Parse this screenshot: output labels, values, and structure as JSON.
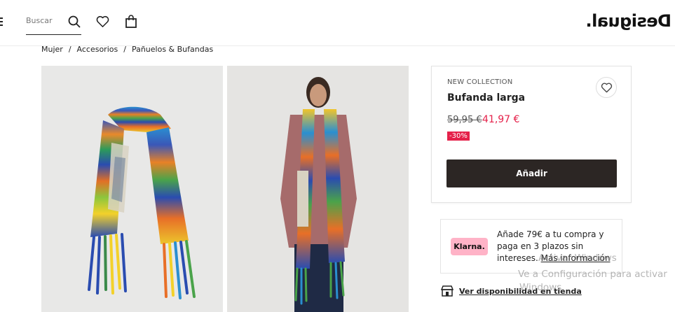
{
  "header": {
    "search_placeholder": "Buscar",
    "logo": "Desigual."
  },
  "breadcrumb": {
    "items": [
      "Mujer",
      "Accesorios",
      "Pañuelos & Bufandas"
    ],
    "separator": "/"
  },
  "product": {
    "collection": "NEW COLLECTION",
    "title": "Bufanda larga",
    "old_price": "59,95 €",
    "new_price": "41,97 €",
    "discount": "-30%",
    "add_button": "Añadir"
  },
  "klarna": {
    "badge": "Klarna.",
    "text": "Añade 79€ a tu compra y paga en 3 plazos sin intereses.",
    "more_info": "Más información"
  },
  "store": {
    "link": "Ver disponibilidad en tienda"
  },
  "watermark": {
    "line1": "Activar Windows",
    "line2": "Ve a Configuración para activar",
    "line3": "Windows."
  },
  "colors": {
    "accent_sale": "#e5214a",
    "button_dark": "#2c2624",
    "klarna_pink": "#ffb3c7"
  },
  "icons": [
    "menu-icon",
    "search-icon",
    "heart-icon",
    "bag-icon",
    "store-icon"
  ]
}
